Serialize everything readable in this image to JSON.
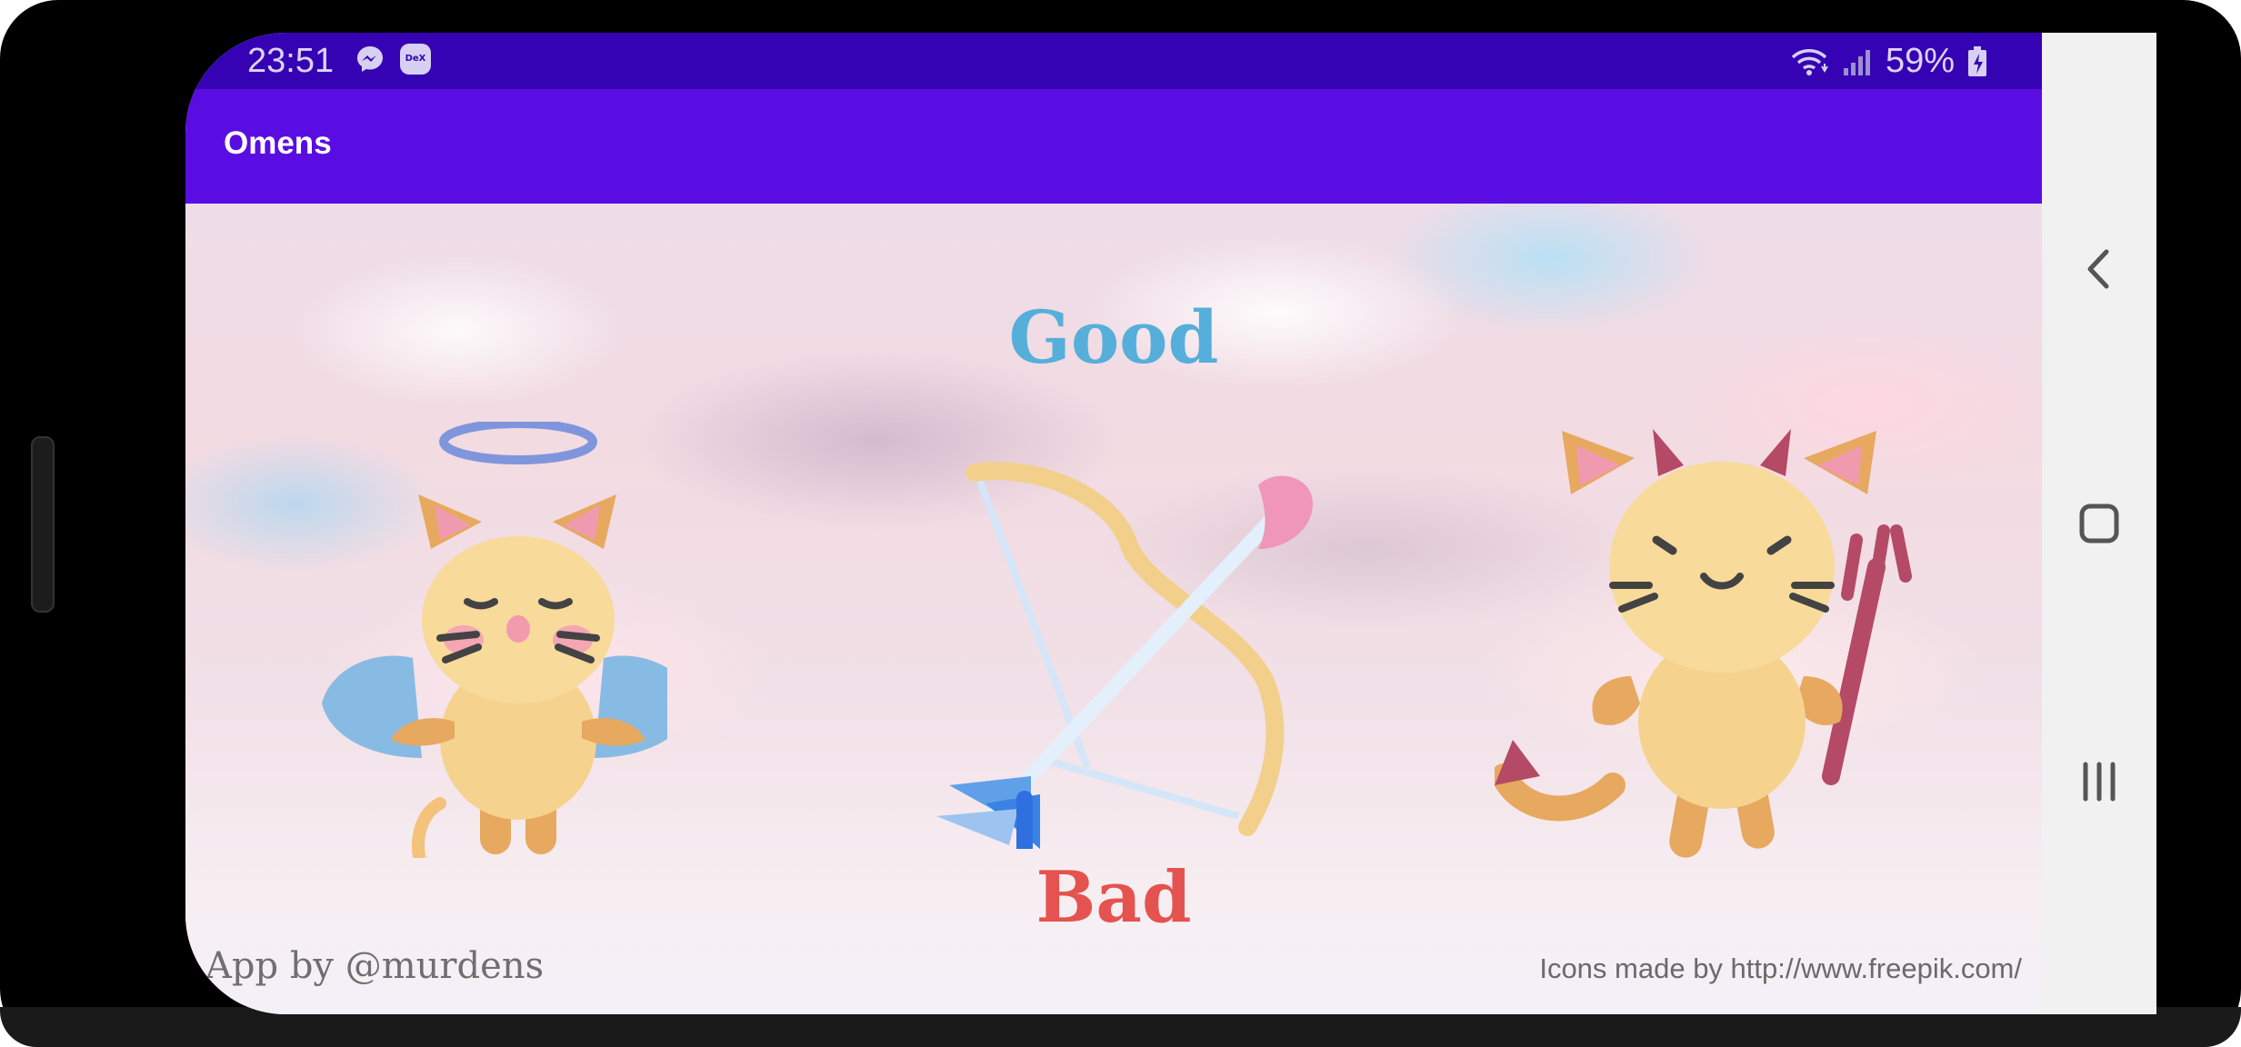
{
  "status_bar": {
    "time": "23:51",
    "battery": "59%",
    "icons": [
      "messenger-icon",
      "dex-icon",
      "wifi-icon",
      "signal-icon",
      "battery-icon"
    ]
  },
  "app_bar": {
    "title": "Omens"
  },
  "main": {
    "good_label": "Good",
    "bad_label": "Bad",
    "credit_left": "App by @murdens",
    "credit_right": "Icons made by http://www.freepik.com/",
    "illustrations": [
      "angel-cat-icon",
      "cupid-bow-arrow-icon",
      "devil-cat-icon"
    ]
  },
  "nav_bar": {
    "buttons": [
      "back-icon",
      "home-icon",
      "recents-icon"
    ]
  },
  "colors": {
    "status_bar": "#3503b3",
    "app_bar": "#5a0de3",
    "good": "#56aedb",
    "bad": "#e4534f",
    "nav_bar": "#f1f1f1"
  }
}
